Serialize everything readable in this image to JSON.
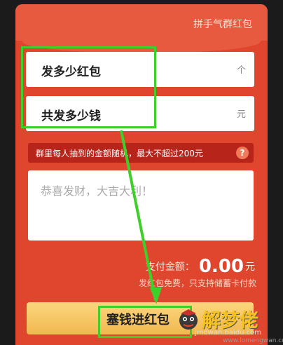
{
  "card": {
    "title": "拼手气群红包"
  },
  "form": {
    "count": {
      "label": "发多少红包",
      "unit": "个"
    },
    "amount": {
      "label": "共发多少钱",
      "unit": "元"
    },
    "hint": {
      "text": "群里每人抽到的金额随机，最大不超过200元",
      "help_icon": "?"
    },
    "message": {
      "placeholder": "恭喜发财，大吉大利！"
    }
  },
  "payment": {
    "label": "支付金额：",
    "amount": "0.00",
    "unit": "元",
    "notice": "发红包免费，只支持储蓄卡付款"
  },
  "submit": {
    "label": "塞钱进红包"
  },
  "watermark": {
    "title": "解梦佬",
    "sub": "jmowan.baidu.com",
    "sub2": "www.lomengwan.com",
    "logo_icon": "mascot-icon"
  },
  "colors": {
    "card_red": "#e0452e",
    "button_gold": "#f2b84f",
    "annotation_green": "#3fcf2a"
  }
}
